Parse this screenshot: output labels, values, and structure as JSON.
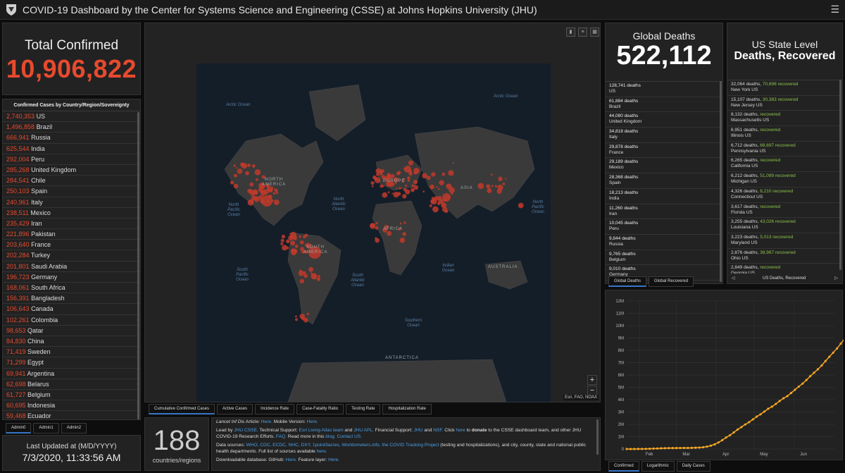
{
  "header": {
    "title": "COVID-19 Dashboard by the Center for Systems Science and Engineering (CSSE) at Johns Hopkins University (JHU)",
    "menu_icon": "hamburger-icon"
  },
  "total": {
    "label": "Total Confirmed",
    "value": "10,906,822"
  },
  "country_list": {
    "title": "Confirmed Cases by Country/Region/Sovereignty",
    "rows": [
      {
        "v": "2,740,353",
        "n": "US"
      },
      {
        "v": "1,496,858",
        "n": "Brazil"
      },
      {
        "v": "666,941",
        "n": "Russia"
      },
      {
        "v": "625,544",
        "n": "India"
      },
      {
        "v": "292,004",
        "n": "Peru"
      },
      {
        "v": "285,268",
        "n": "United Kingdom"
      },
      {
        "v": "284,541",
        "n": "Chile"
      },
      {
        "v": "250,103",
        "n": "Spain"
      },
      {
        "v": "240,961",
        "n": "Italy"
      },
      {
        "v": "238,511",
        "n": "Mexico"
      },
      {
        "v": "235,429",
        "n": "Iran"
      },
      {
        "v": "221,896",
        "n": "Pakistan"
      },
      {
        "v": "203,640",
        "n": "France"
      },
      {
        "v": "202,284",
        "n": "Turkey"
      },
      {
        "v": "201,801",
        "n": "Saudi Arabia"
      },
      {
        "v": "196,723",
        "n": "Germany"
      },
      {
        "v": "168,061",
        "n": "South Africa"
      },
      {
        "v": "156,391",
        "n": "Bangladesh"
      },
      {
        "v": "106,643",
        "n": "Canada"
      },
      {
        "v": "102,261",
        "n": "Colombia"
      },
      {
        "v": "98,653",
        "n": "Qatar"
      },
      {
        "v": "84,830",
        "n": "China"
      },
      {
        "v": "71,419",
        "n": "Sweden"
      },
      {
        "v": "71,299",
        "n": "Egypt"
      },
      {
        "v": "69,941",
        "n": "Argentina"
      },
      {
        "v": "62,698",
        "n": "Belarus"
      },
      {
        "v": "61,727",
        "n": "Belgium"
      },
      {
        "v": "60,695",
        "n": "Indonesia"
      },
      {
        "v": "59,468",
        "n": "Ecuador"
      }
    ],
    "tabs": [
      "Admin0",
      "Admin1",
      "Admin2"
    ]
  },
  "updated": {
    "label": "Last Updated at (M/D/YYYY)",
    "value": "7/3/2020, 11:33:56 AM"
  },
  "map": {
    "oceans": [
      "Arctic Ocean",
      "Arctic Ocean",
      "North Pacific Ocean",
      "North Atlantic Ocean",
      "North Pacific Ocean",
      "South Pacific Ocean",
      "South Atlantic Ocean",
      "Indian Ocean",
      "Southern Ocean"
    ],
    "continents": [
      "NORTH AMERICA",
      "EUROPE",
      "ASIA",
      "AFRICA",
      "SOUTH AMERICA",
      "AUSTRALIA",
      "ANTARCTICA"
    ],
    "attribution": "Esri, FAO, NOAA",
    "zoom_in": "+",
    "zoom_out": "−",
    "tabs": [
      "Cumulative Confirmed Cases",
      "Active Cases",
      "Incidence Rate",
      "Case-Fatality Ratio",
      "Testing Rate",
      "Hospitalization Rate"
    ]
  },
  "country_count": {
    "value": "188",
    "label": "countries/regions"
  },
  "info": {
    "p1a": "Lancet Inf Dis",
    "p1b": " Article: ",
    "p1c": "Here.",
    "p1d": " Mobile Version: ",
    "p1e": "Here.",
    "p2a": "Lead by ",
    "p2b": "JHU CSSE.",
    "p2c": " Technical Support: ",
    "p2d": "Esri Living Atlas team",
    "p2e": " and ",
    "p2f": "JHU APL.",
    "p2g": " Financial Support: ",
    "p2h": "JHU",
    "p2i": " and ",
    "p2j": "NSF.",
    "p2k": " Click ",
    "p2l": "here",
    "p2m": " to ",
    "p2n": "donate",
    "p2o": " to the CSSE dashboard team, and other JHU COVID-19 Research Efforts. ",
    "p2p": "FAQ.",
    "p2q": " Read more in this ",
    "p2r": "blog.",
    "p2s": " ",
    "p2t": "Contact US.",
    "p3a": "Data sources: ",
    "p3b": "WHO, CDC, ECDC, NHC, DXY, 1point3acres, Worldometers.info, the COVID Tracking Project",
    "p3c": " (testing and hospitalizations), and city, county, state and national public health departments. Full list of sources available ",
    "p3d": "here.",
    "p4a": "Downloadable database: GitHub: ",
    "p4b": "Here.",
    "p4c": " Feature layer: ",
    "p4d": "Here."
  },
  "global_deaths": {
    "label": "Global Deaths",
    "value": "522,112",
    "rows": [
      {
        "d": "128,741 deaths",
        "c": "US"
      },
      {
        "d": "61,884 deaths",
        "c": "Brazil"
      },
      {
        "d": "44,080 deaths",
        "c": "United Kingdom"
      },
      {
        "d": "34,818 deaths",
        "c": "Italy"
      },
      {
        "d": "29,878 deaths",
        "c": "France"
      },
      {
        "d": "29,189 deaths",
        "c": "Mexico"
      },
      {
        "d": "28,368 deaths",
        "c": "Spain"
      },
      {
        "d": "18,213 deaths",
        "c": "India"
      },
      {
        "d": "11,260 deaths",
        "c": "Iran"
      },
      {
        "d": "10,045 deaths",
        "c": "Peru"
      },
      {
        "d": "9,844 deaths",
        "c": "Russia"
      },
      {
        "d": "9,765 deaths",
        "c": "Belgium"
      },
      {
        "d": "9,010 deaths",
        "c": "Germany"
      }
    ],
    "tabs": [
      "Global Deaths",
      "Global Recovered"
    ]
  },
  "us_state": {
    "label": "US State Level",
    "label2": "Deaths, Recovered",
    "rows": [
      {
        "d": "32,064 deaths, ",
        "r": "70,698 recovered",
        "s": "New York US"
      },
      {
        "d": "15,107 deaths, ",
        "r": "30,383 recovered",
        "s": "New Jersey US"
      },
      {
        "d": "8,132 deaths, ",
        "r": " recovered",
        "s": "Massachusetts US"
      },
      {
        "d": "6,951 deaths, ",
        "r": " recovered",
        "s": "Illinois US"
      },
      {
        "d": "6,712 deaths, ",
        "r": "68,697 recovered",
        "s": "Pennsylvania US"
      },
      {
        "d": "6,265 deaths, ",
        "r": " recovered",
        "s": "California US"
      },
      {
        "d": "6,212 deaths, ",
        "r": "51,099 recovered",
        "s": "Michigan US"
      },
      {
        "d": "4,326 deaths, ",
        "r": "8,210 recovered",
        "s": "Connecticut US"
      },
      {
        "d": "3,617 deaths, ",
        "r": " recovered",
        "s": "Florida US"
      },
      {
        "d": "3,255 deaths, ",
        "r": "43,026 recovered",
        "s": "Louisiana US"
      },
      {
        "d": "3,223 deaths, ",
        "r": "5,013 recovered",
        "s": "Maryland US"
      },
      {
        "d": "2,876 deaths, ",
        "r": "38,987 recovered",
        "s": "Ohio US"
      },
      {
        "d": "2,849 deaths, ",
        "r": " recovered",
        "s": "Georgia US"
      }
    ],
    "pager_label": "US Deaths, Recovered",
    "pager_prev": "◁",
    "pager_next": "▷"
  },
  "chart_data": {
    "type": "line",
    "x_ticks": [
      "Feb",
      "Mar",
      "Apr",
      "May",
      "Jun"
    ],
    "y_ticks": [
      "0",
      "1M",
      "2M",
      "3M",
      "4M",
      "5M",
      "6M",
      "7M",
      "8M",
      "9M",
      "10M",
      "11M",
      "12M"
    ],
    "ylim": [
      0,
      12000000
    ],
    "series": [
      {
        "values": [
          555,
          1000,
          2100,
          5500,
          9800,
          17000,
          24500,
          34800,
          43100,
          60400,
          69200,
          75100,
          78700,
          80600,
          82800,
          85200,
          88500,
          95100,
          105800,
          118600,
          145200,
          197200,
          272200,
          378500,
          532800,
          721600,
          935200,
          1118000,
          1345000,
          1579000,
          1778000,
          1990000,
          2181000,
          2402000,
          2627000,
          2812000,
          3038000,
          3263000,
          3438000,
          3654000,
          3894000,
          4117000,
          4288000,
          4542000,
          4803000,
          5062000,
          5305000,
          5592000,
          5905000,
          6186000,
          6465000,
          6770000,
          7133000,
          7477000,
          7812000,
          8153000,
          8546000,
          8939000,
          9305000,
          9700000,
          10146000,
          10589000,
          10906822
        ],
        "x_start": "2020-01-22",
        "x_step_days": 3
      }
    ],
    "x_dates": [
      "2020-02-01",
      "2020-03-01",
      "2020-04-01",
      "2020-05-01",
      "2020-06-01"
    ],
    "tabs": [
      "Confirmed",
      "Logarithmic",
      "Daily Cases"
    ]
  },
  "colors": {
    "accent": "#e84a2e",
    "chart_line": "#f5a623",
    "recovered": "#8bc34a",
    "link": "#4aa0e8"
  }
}
